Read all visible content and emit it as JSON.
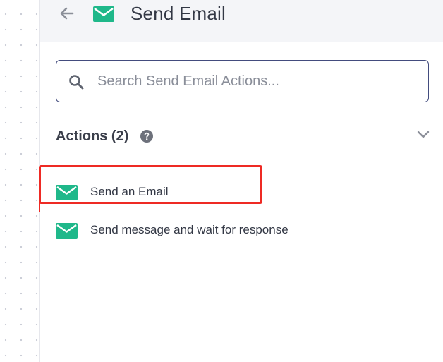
{
  "header": {
    "title": "Send Email",
    "back_icon": "arrow-left-icon",
    "app_icon": "envelope-icon"
  },
  "search": {
    "placeholder": "Search Send Email Actions...",
    "value": ""
  },
  "actions_section": {
    "title": "Actions (2)",
    "help_icon": "question-circle-icon",
    "collapse_icon": "chevron-down-icon"
  },
  "actions": [
    {
      "label": "Send an Email",
      "icon": "envelope-icon"
    },
    {
      "label": "Send message and wait for response",
      "icon": "envelope-icon"
    }
  ],
  "colors": {
    "brand_green": "#1fb88a",
    "highlight_red": "#ee2a24",
    "search_border": "#434c7e",
    "header_bg": "#f4f5f8"
  }
}
